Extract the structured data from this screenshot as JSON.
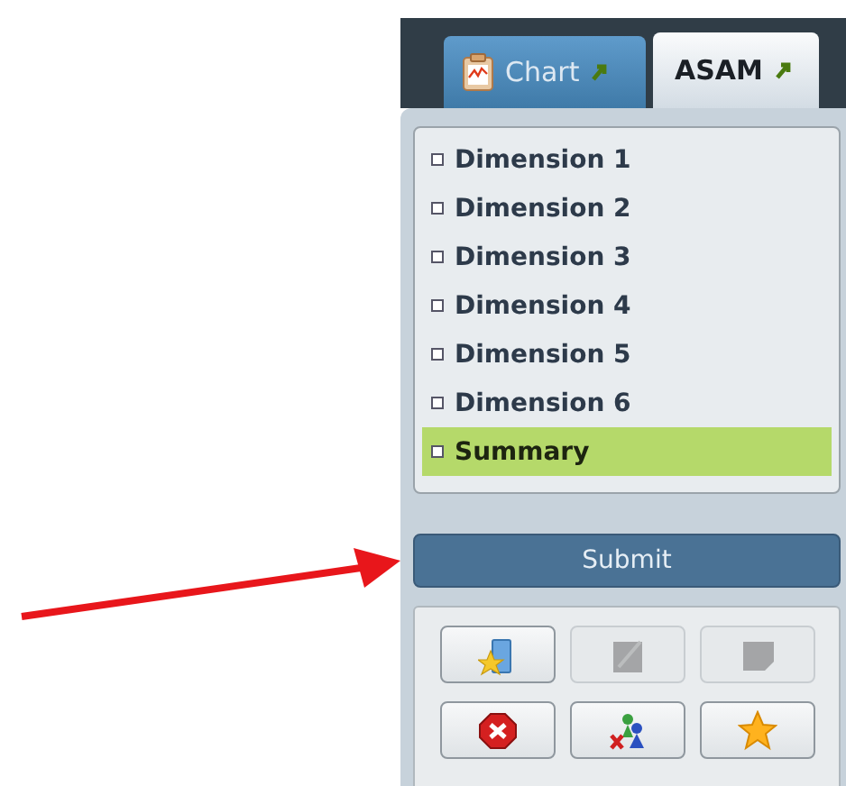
{
  "tabs": [
    {
      "label": "Chart",
      "selected": false
    },
    {
      "label": "ASAM",
      "selected": true
    }
  ],
  "list": {
    "items": [
      {
        "label": "Dimension 1",
        "selected": false
      },
      {
        "label": "Dimension 2",
        "selected": false
      },
      {
        "label": "Dimension 3",
        "selected": false
      },
      {
        "label": "Dimension 4",
        "selected": false
      },
      {
        "label": "Dimension 5",
        "selected": false
      },
      {
        "label": "Dimension 6",
        "selected": false
      },
      {
        "label": "Summary",
        "selected": true
      }
    ]
  },
  "submit_button": {
    "label": "Submit"
  },
  "toolbar": {
    "buttons": [
      {
        "disabled": false
      },
      {
        "disabled": true
      },
      {
        "disabled": true
      },
      {
        "disabled": false
      },
      {
        "disabled": false
      },
      {
        "disabled": false
      }
    ]
  }
}
